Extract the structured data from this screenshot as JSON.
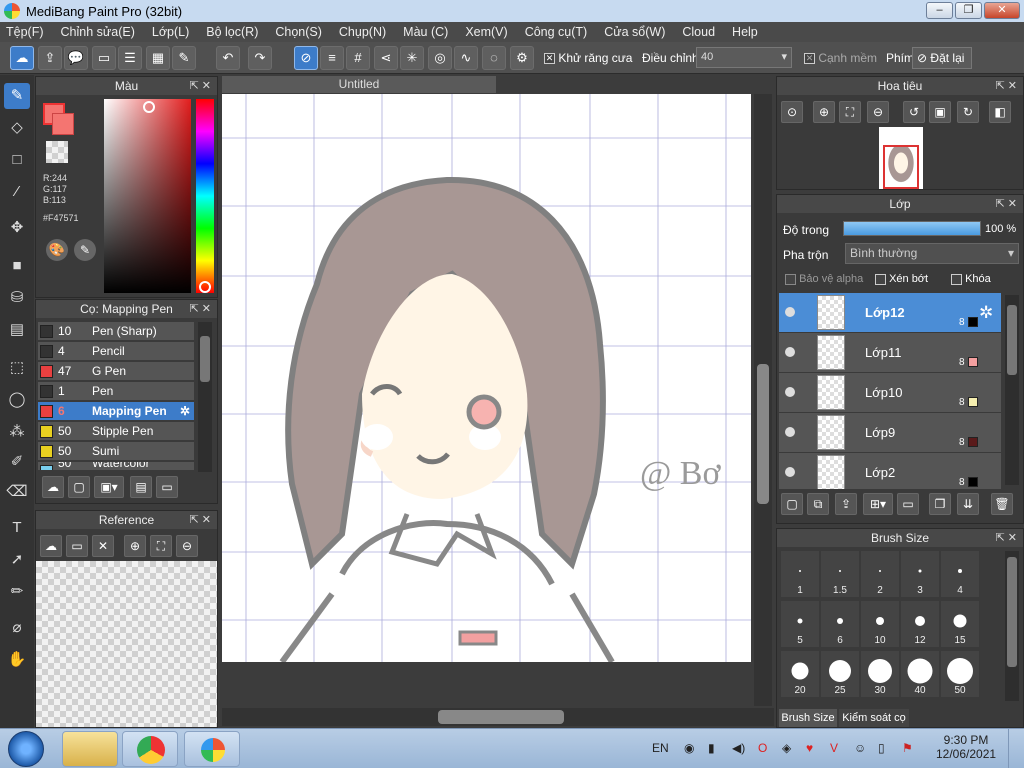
{
  "window": {
    "title": "MediBang Paint Pro (32bit)",
    "min": "–",
    "max": "❐",
    "close": "✕"
  },
  "menu": [
    "Tệp(F)",
    "Chỉnh sửa(E)",
    "Lớp(L)",
    "Bộ lọc(R)",
    "Chọn(S)",
    "Chụp(N)",
    "Màu (C)",
    "Xem(V)",
    "Công cụ(T)",
    "Cửa sổ(W)",
    "Cloud",
    "Help"
  ],
  "toolbar": {
    "antialias_label": "Khử răng cưa",
    "adjust_label": "Điều chỉnh",
    "adjust_value": "40",
    "soft_edge_label": "Cạnh mềm",
    "key_label": "Phím",
    "reset_label": "Đặt lại"
  },
  "color_panel": {
    "title": "Màu",
    "r": "R:244",
    "g": "G:117",
    "b": "B:113",
    "hex": "#F47571",
    "foreground": "#F47571"
  },
  "brush_panel": {
    "title": "Cọ: Mapping Pen",
    "items": [
      {
        "size": "10",
        "name": "Pen (Sharp)",
        "color": "#333333"
      },
      {
        "size": "4",
        "name": "Pencil",
        "color": "#333333"
      },
      {
        "size": "47",
        "name": "G Pen",
        "color": "#e84040"
      },
      {
        "size": "1",
        "name": "Pen",
        "color": "#333333"
      },
      {
        "size": "6",
        "name": "Mapping Pen",
        "color": "#e84040"
      },
      {
        "size": "50",
        "name": "Stipple Pen",
        "color": "#e8d020"
      },
      {
        "size": "50",
        "name": "Sumi",
        "color": "#e8d020"
      },
      {
        "size": "50",
        "name": "Watercolor",
        "color": "#7ad0f0"
      }
    ]
  },
  "reference_panel": {
    "title": "Reference"
  },
  "document": {
    "tab": "Untitled",
    "signature": "@ Bơ"
  },
  "navigator_panel": {
    "title": "Hoa tiêu"
  },
  "layer_panel": {
    "title": "Lớp",
    "opacity_label": "Độ trong",
    "opacity_value": "100 %",
    "opacity_fraction": 1.0,
    "blend_label": "Pha trộn",
    "blend_value": "Bình thường",
    "protect_alpha": "Bảo vệ alpha",
    "clipping": "Xén bớt",
    "lock": "Khóa",
    "layers": [
      {
        "name": "Lớp12",
        "opacity": "8",
        "color": "#000000"
      },
      {
        "name": "Lớp11",
        "opacity": "8",
        "color": "#f4a0a0"
      },
      {
        "name": "Lớp10",
        "opacity": "8",
        "color": "#f6efb0"
      },
      {
        "name": "Lớp9",
        "opacity": "8",
        "color": "#5a1a1a"
      },
      {
        "name": "Lớp2",
        "opacity": "8",
        "color": "#000000"
      }
    ]
  },
  "brush_size_panel": {
    "title": "Brush Size",
    "sizes": [
      "1",
      "1.5",
      "2",
      "3",
      "4",
      "5",
      "6",
      "10",
      "12",
      "15",
      "20",
      "25",
      "30",
      "40",
      "50"
    ],
    "tab_brush_size": "Brush Size",
    "tab_brush_control": "Kiểm soát cọ"
  },
  "taskbar": {
    "language": "EN",
    "time": "9:30 PM",
    "date": "12/06/2021"
  }
}
